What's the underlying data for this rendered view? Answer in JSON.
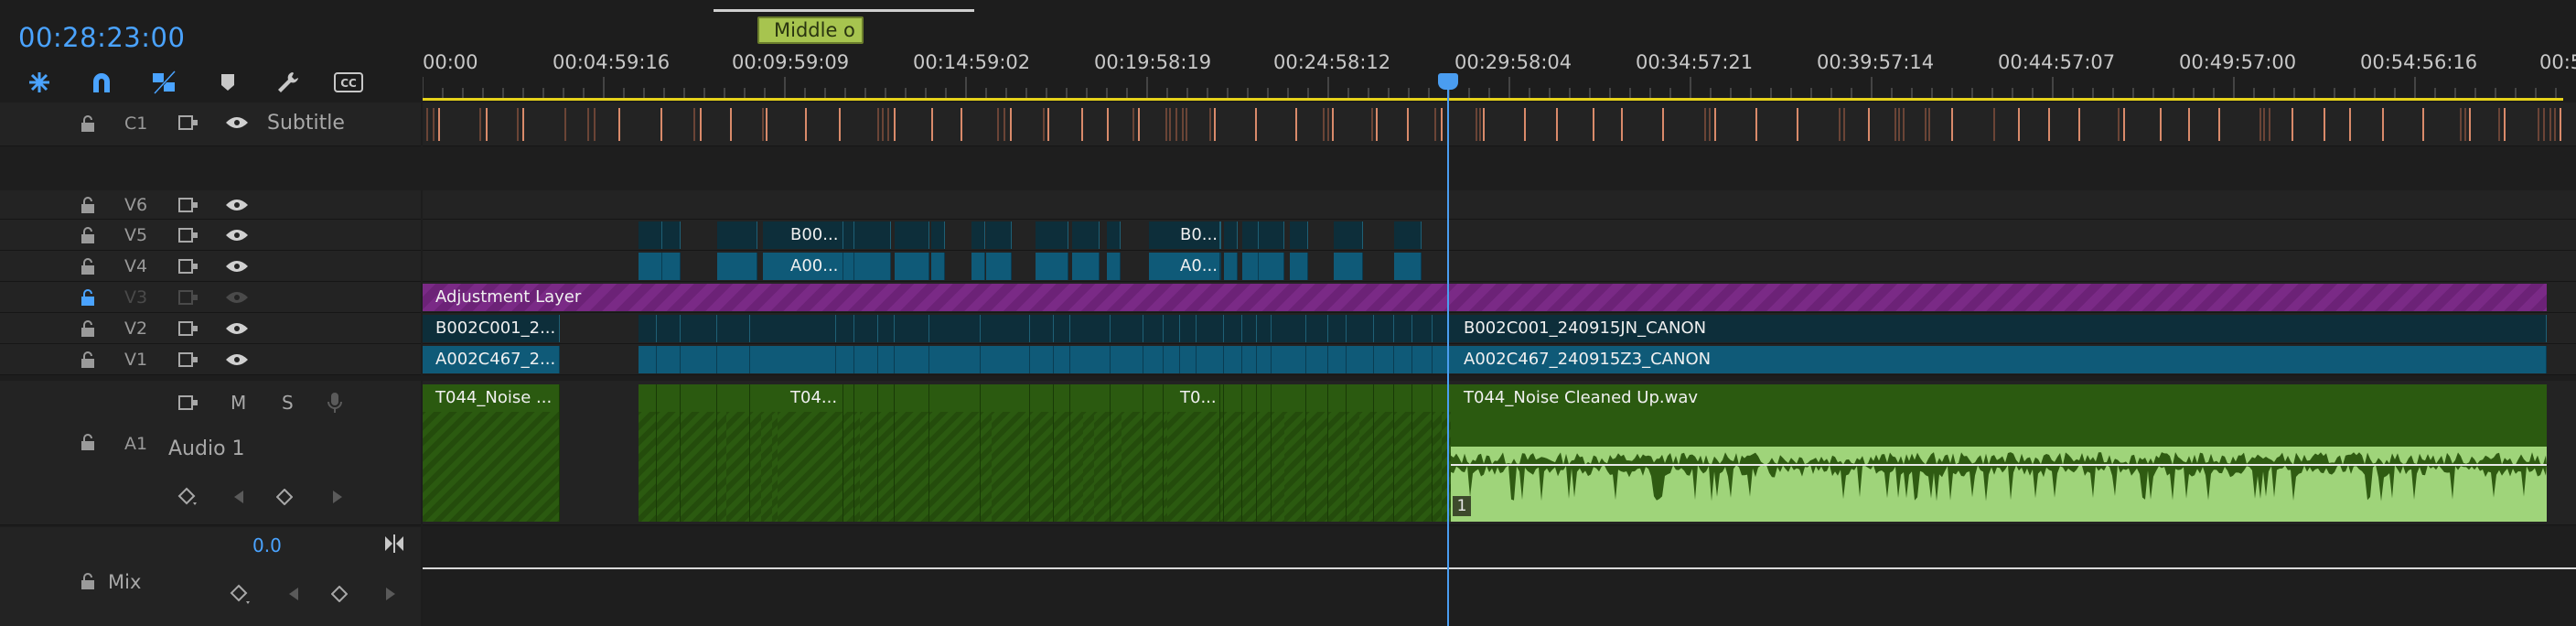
{
  "header": {
    "timecode": "00:28:23:00",
    "marker_label": "Middle o",
    "tools": [
      "snap-icon",
      "magnet-icon",
      "linked-selection-icon",
      "marker-icon",
      "wrench-icon",
      "cc-icon"
    ]
  },
  "ruler": {
    "labels": [
      "00:00",
      "00:04:59:16",
      "00:09:59:09",
      "00:14:59:02",
      "00:19:58:19",
      "00:24:58:12",
      "00:29:58:04",
      "00:34:57:21",
      "00:39:57:14",
      "00:44:57:07",
      "00:49:57:00",
      "00:54:56:16",
      "00:5"
    ]
  },
  "tracks": {
    "c1": {
      "id": "C1",
      "name": "Subtitle"
    },
    "v6": {
      "id": "V6"
    },
    "v5": {
      "id": "V5"
    },
    "v4": {
      "id": "V4"
    },
    "v3": {
      "id": "V3"
    },
    "v2": {
      "id": "V2"
    },
    "v1": {
      "id": "V1"
    },
    "a1": {
      "id": "A1",
      "name": "Audio 1",
      "m": "M",
      "s": "S"
    },
    "mix": {
      "name": "Mix",
      "value": "0.0"
    }
  },
  "clips": {
    "adjustment": "Adjustment Layer",
    "v5_a": "B00...",
    "v5_b": "B0...",
    "v4_a": "A00...",
    "v4_b": "A0...",
    "v2_left": "B002C001_2...",
    "v2_right": "B002C001_240915JN_CANON",
    "v1_left": "A002C467_2...",
    "v1_right": "A002C467_240915Z3_CANON",
    "a1_left": "T044_Noise ...",
    "a1_mid": "T04...",
    "a1_mid2": "T0...",
    "a1_right": "T044_Noise Cleaned Up.wav",
    "a1_badge": "1"
  },
  "colors": {
    "accent": "#4aa3ff",
    "adjustment": "#7a2a86",
    "video_clip": "#0f5a78",
    "audio_clip": "#2b5a10",
    "waveform": "#9fd47a",
    "subtitle_line": "#e6d21a"
  }
}
